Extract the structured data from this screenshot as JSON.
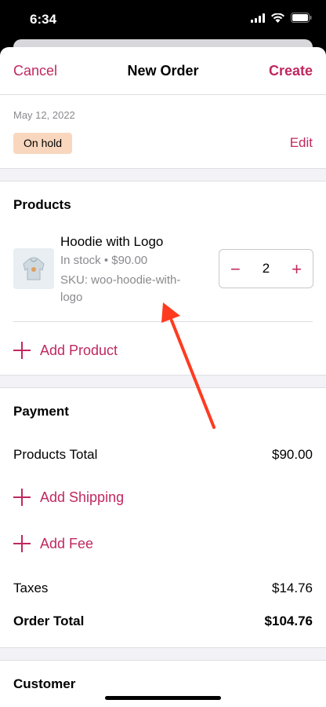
{
  "status_bar": {
    "time": "6:34"
  },
  "nav": {
    "cancel": "Cancel",
    "title": "New Order",
    "create": "Create"
  },
  "order": {
    "date": "May 12, 2022",
    "status": "On hold",
    "edit": "Edit"
  },
  "products": {
    "title": "Products",
    "items": [
      {
        "name": "Hoodie with Logo",
        "stock": "In stock • $90.00",
        "sku": "SKU: woo-hoodie-with-logo",
        "quantity": "2"
      }
    ],
    "add_product": "Add Product"
  },
  "payment": {
    "title": "Payment",
    "products_total_label": "Products Total",
    "products_total_value": "$90.00",
    "add_shipping": "Add Shipping",
    "add_fee": "Add Fee",
    "taxes_label": "Taxes",
    "taxes_value": "$14.76",
    "order_total_label": "Order Total",
    "order_total_value": "$104.76"
  },
  "customer": {
    "title": "Customer"
  },
  "colors": {
    "accent": "#c0285f",
    "badge": "#f8d7be",
    "annotation": "#ff3b1f"
  }
}
